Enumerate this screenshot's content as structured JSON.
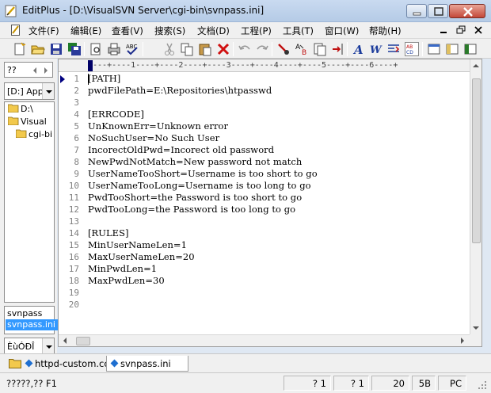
{
  "window": {
    "title": "EditPlus - [D:\\VisualSVN Server\\cgi-bin\\svnpass.ini]"
  },
  "menu": [
    "文件(F)",
    "编辑(E)",
    "查看(V)",
    "搜索(S)",
    "文档(D)",
    "工程(P)",
    "工具(T)",
    "窗口(W)",
    "帮助(H)"
  ],
  "left_panel": {
    "tab_label": "??",
    "drive_combo": "[D:] App",
    "tree": [
      "D:\\",
      "Visual",
      "cgi-bi"
    ],
    "files": [
      "svnpass",
      "svnpass.ini"
    ],
    "filter_combo": "ÈùÓÐÎ"
  },
  "editor": {
    "ruler": "----+----1----+----2----+----3----+----4----+----5----+----6----+",
    "lines": [
      "[PATH]",
      "pwdFilePath=E:\\Repositories\\htpasswd",
      "",
      "[ERRCODE]",
      "UnKnownErr=Unknown error",
      "NoSuchUser=No Such User",
      "IncorectOldPwd=Incorect old password",
      "NewPwdNotMatch=New password not match",
      "UserNameTooShort=Username is too short to go",
      "UserNameTooLong=Username is too long to go",
      "PwdTooShort=the Password is too short to go",
      "PwdTooLong=the Password is too long to go",
      "",
      "[RULES]",
      "MinUserNameLen=1",
      "MaxUserNameLen=20",
      "MinPwdLen=1",
      "MaxPwdLen=30",
      "",
      ""
    ],
    "line_numbers": [
      "1",
      "2",
      "3",
      "4",
      "5",
      "6",
      "7",
      "8",
      "9",
      "10",
      "11",
      "12",
      "13",
      "14",
      "15",
      "16",
      "17",
      "18",
      "19",
      "20"
    ]
  },
  "tabs": [
    "httpd-custom.co",
    "svnpass.ini"
  ],
  "status": {
    "help": "?????,?? F1",
    "line": "? 1",
    "col": "? 1",
    "lines": "20",
    "size": "5B",
    "mode": "PC"
  },
  "colors": {
    "accent": "#3399ff",
    "title_bar": "#c3d5ec",
    "close": "#c3483a"
  }
}
